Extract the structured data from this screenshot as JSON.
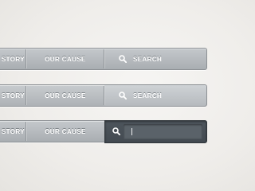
{
  "navbars": [
    {
      "state": "default",
      "items": {
        "story_label": "STORY",
        "cause_label": "OUR CAUSE",
        "search_label": "SEARCH"
      }
    },
    {
      "state": "hover",
      "items": {
        "story_label": "STORY",
        "cause_label": "OUR CAUSE",
        "search_label": "SEARCH"
      }
    },
    {
      "state": "active",
      "items": {
        "story_label": "STORY",
        "cause_label": "OUR CAUSE",
        "search_value": ""
      }
    }
  ],
  "icons": {
    "search": "search-icon"
  },
  "colors": {
    "bar_top": "#c4c8cb",
    "bar_bottom": "#a9aeb2",
    "active_bg": "#4d555c",
    "field_bg": "#5a6269",
    "text": "#ffffff"
  }
}
